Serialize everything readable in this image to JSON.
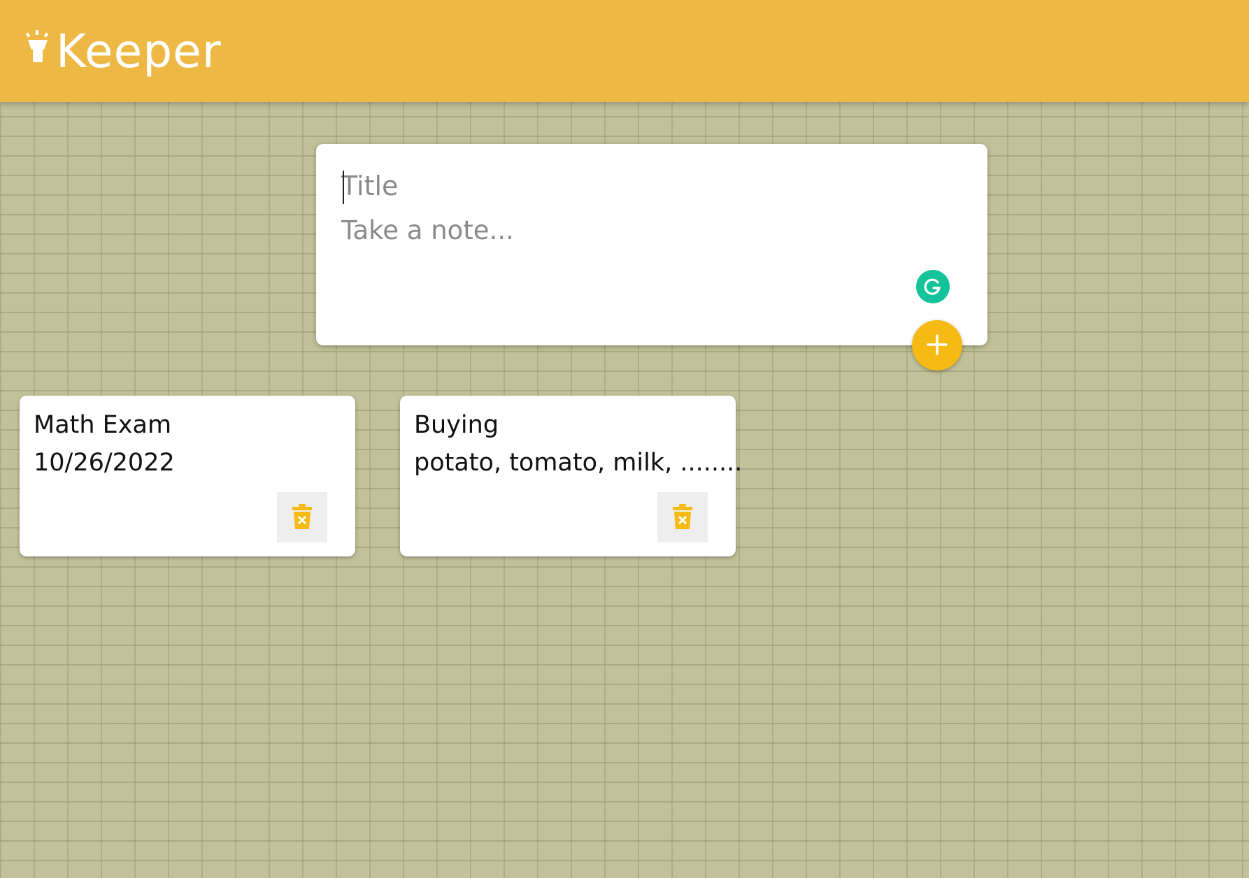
{
  "app": {
    "name": "Keeper",
    "icon": "highlight-lamp-icon"
  },
  "colors": {
    "header": "#edb944",
    "accent": "#f5ba13",
    "grammarly": "#15c39a"
  },
  "compose": {
    "title_placeholder": "Title",
    "content_placeholder": "Take a note...",
    "add_icon": "plus-icon",
    "assistant_icon": "grammarly-icon"
  },
  "notes": [
    {
      "title": "Math Exam",
      "content": "10/26/2022",
      "delete_icon": "trash-icon"
    },
    {
      "title": "Buying",
      "content": "potato, tomato, milk, ........",
      "delete_icon": "trash-icon"
    }
  ]
}
